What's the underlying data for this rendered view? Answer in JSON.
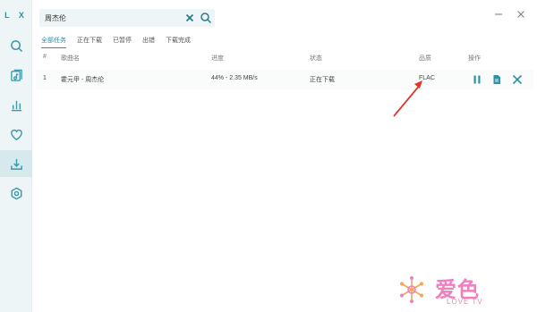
{
  "app": {
    "logo": "L X"
  },
  "sidebar": {
    "items": [
      {
        "icon": "search-icon"
      },
      {
        "icon": "music-playlist-icon"
      },
      {
        "icon": "chart-icon"
      },
      {
        "icon": "heart-icon"
      },
      {
        "icon": "download-icon",
        "active": true
      },
      {
        "icon": "settings-icon"
      }
    ]
  },
  "search": {
    "value": "周杰伦"
  },
  "tabs": [
    "全部任务",
    "正在下载",
    "已暂停",
    "出错",
    "下载完成"
  ],
  "table": {
    "headers": [
      "#",
      "歌曲名",
      "进度",
      "状态",
      "品质",
      "操作"
    ],
    "rows": [
      {
        "num": "1",
        "name": "霍元甲 - 周杰伦",
        "progress": "44% - 2.35 MB/s",
        "status": "正在下载",
        "quality": "FLAC"
      }
    ]
  },
  "watermark": {
    "title": "爱色",
    "subtitle": "LOVE TV"
  },
  "colors": {
    "accent": "#2e8fa6",
    "sidebar": "#eef5f6",
    "arrow": "#e0362a"
  }
}
